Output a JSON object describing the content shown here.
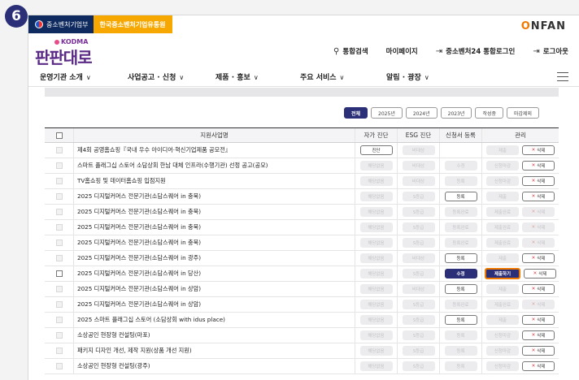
{
  "step": "6",
  "topbar": {
    "ministry": "중소벤처기업부",
    "agency": "한국중소벤처기업유통원",
    "brand": "ONFAN",
    "brand_first": "O",
    "brand_rest": "NFAN"
  },
  "logo": {
    "sub": "KODMA",
    "main": "판판대로"
  },
  "util": {
    "search": "통합검색",
    "mypage": "마이페이지",
    "login24": "중소벤처24 통합로그인",
    "logout": "로그아웃"
  },
  "nav": [
    {
      "label": "운영기관 소개"
    },
    {
      "label": "사업공고 · 신청"
    },
    {
      "label": "제품 · 홍보"
    },
    {
      "label": "주요 서비스"
    },
    {
      "label": "알림 · 광장"
    }
  ],
  "filters": [
    "전체",
    "2025년",
    "2024년",
    "2023년",
    "작성중",
    "마감제외"
  ],
  "table": {
    "headers": {
      "name": "지원사업명",
      "self": "자가 진단",
      "esg": "ESG 진단",
      "reg": "신청서 등록",
      "mgmt": "관리"
    },
    "rows": [
      {
        "name": "제4회 공영홈쇼핑『국내 우수 아이디어·혁신기업제품 공모전』",
        "self": "진단",
        "self_state": "outline",
        "esg": "비대상",
        "esg_state": "disabled",
        "reg": "",
        "reg_state": "none",
        "mgmt": "제출",
        "mgmt_state": "disabled",
        "del": "삭제",
        "del_state": "active",
        "checkbox": "dim"
      },
      {
        "name": "스마트 플래그십 스토어 소담상회 한남 대체 인프라(수행기관) 선정 공고(공모)",
        "self": "해당없음",
        "self_state": "disabled",
        "esg": "비대상",
        "esg_state": "disabled",
        "reg": "수정",
        "reg_state": "disabled",
        "mgmt": "신청마감",
        "mgmt_state": "disabled",
        "del": "삭제",
        "del_state": "active",
        "checkbox": "dim"
      },
      {
        "name": "TV홈쇼핑 및 데이터홈쇼핑 입점지원",
        "self": "해당없음",
        "self_state": "disabled",
        "esg": "비대상",
        "esg_state": "disabled",
        "reg": "등록",
        "reg_state": "disabled",
        "mgmt": "신청마감",
        "mgmt_state": "disabled",
        "del": "삭제",
        "del_state": "active",
        "checkbox": "dim"
      },
      {
        "name": "2025 디지털커머스 전문기관(소담스퀘어 in 충북)",
        "self": "해당없음",
        "self_state": "disabled",
        "esg": "S등급",
        "esg_state": "disabled",
        "reg": "등록",
        "reg_state": "outline",
        "mgmt": "제출",
        "mgmt_state": "disabled",
        "del": "삭제",
        "del_state": "active",
        "checkbox": "dim"
      },
      {
        "name": "2025 디지털커머스 전문기관(소담스퀘어 in 충북)",
        "self": "해당없음",
        "self_state": "disabled",
        "esg": "S등급",
        "esg_state": "disabled",
        "reg": "등록완료",
        "reg_state": "disabled",
        "mgmt": "제출완료",
        "mgmt_state": "disabled",
        "del": "삭제",
        "del_state": "dim",
        "checkbox": "dim"
      },
      {
        "name": "2025 디지털커머스 전문기관(소담스퀘어 in 충북)",
        "self": "해당없음",
        "self_state": "disabled",
        "esg": "S등급",
        "esg_state": "disabled",
        "reg": "등록완료",
        "reg_state": "disabled",
        "mgmt": "제출완료",
        "mgmt_state": "disabled",
        "del": "삭제",
        "del_state": "dim",
        "checkbox": "dim"
      },
      {
        "name": "2025 디지털커머스 전문기관(소담스퀘어 in 충북)",
        "self": "해당없음",
        "self_state": "disabled",
        "esg": "S등급",
        "esg_state": "disabled",
        "reg": "등록완료",
        "reg_state": "disabled",
        "mgmt": "제출완료",
        "mgmt_state": "disabled",
        "del": "삭제",
        "del_state": "dim",
        "checkbox": "dim"
      },
      {
        "name": "2025 디지털커머스 전문기관(소담스퀘어 in 광주)",
        "self": "해당없음",
        "self_state": "disabled",
        "esg": "비대상",
        "esg_state": "disabled",
        "reg": "등록",
        "reg_state": "outline",
        "mgmt": "제출",
        "mgmt_state": "disabled",
        "del": "삭제",
        "del_state": "active",
        "checkbox": "dim"
      },
      {
        "name": "2025 디지털커머스 전문기관(소담스퀘어 in 당산)",
        "self": "해당없음",
        "self_state": "disabled",
        "esg": "S등급",
        "esg_state": "disabled",
        "reg": "수정",
        "reg_state": "navy",
        "mgmt": "제출하기",
        "mgmt_state": "submit",
        "del": "삭제",
        "del_state": "active",
        "checkbox": "active"
      },
      {
        "name": "2025 디지털커머스 전문기관(소담스퀘어 in 상암)",
        "self": "해당없음",
        "self_state": "disabled",
        "esg": "비대상",
        "esg_state": "disabled",
        "reg": "등록",
        "reg_state": "outline",
        "mgmt": "제출",
        "mgmt_state": "disabled",
        "del": "삭제",
        "del_state": "active",
        "checkbox": "dim"
      },
      {
        "name": "2025 디지털커머스 전문기관(소담스퀘어 in 상암)",
        "self": "해당없음",
        "self_state": "disabled",
        "esg": "S등급",
        "esg_state": "disabled",
        "reg": "등록완료",
        "reg_state": "disabled",
        "mgmt": "제출완료",
        "mgmt_state": "disabled",
        "del": "삭제",
        "del_state": "dim",
        "checkbox": "dim"
      },
      {
        "name": "2025 스마트 플래그십 스토어 (소담상회 with idus place)",
        "self": "해당없음",
        "self_state": "disabled",
        "esg": "S등급",
        "esg_state": "disabled",
        "reg": "등록",
        "reg_state": "outline",
        "mgmt": "제출",
        "mgmt_state": "disabled",
        "del": "삭제",
        "del_state": "active",
        "checkbox": "dim"
      },
      {
        "name": "소상공인 현장형 컨설팅(마포)",
        "self": "해당없음",
        "self_state": "disabled",
        "esg": "S등급",
        "esg_state": "disabled",
        "reg": "등록",
        "reg_state": "disabled",
        "mgmt": "신청마감",
        "mgmt_state": "disabled",
        "del": "삭제",
        "del_state": "active",
        "checkbox": "dim"
      },
      {
        "name": "패키지 디자인 개선, 제작 지원(상품 개선 지원)",
        "self": "해당없음",
        "self_state": "disabled",
        "esg": "S등급",
        "esg_state": "disabled",
        "reg": "등록",
        "reg_state": "disabled",
        "mgmt": "신청마감",
        "mgmt_state": "disabled",
        "del": "삭제",
        "del_state": "active",
        "checkbox": "dim"
      },
      {
        "name": "소상공인 현장형 컨설팅(광주)",
        "self": "해당없음",
        "self_state": "disabled",
        "esg": "S등급",
        "esg_state": "disabled",
        "reg": "등록",
        "reg_state": "disabled",
        "mgmt": "신청마감",
        "mgmt_state": "disabled",
        "del": "삭제",
        "del_state": "active",
        "checkbox": "dim"
      }
    ]
  },
  "colors": {
    "navy": "#2b2f77",
    "orange": "#f07a00",
    "yellow": "#f6a800",
    "purple": "#5a2a86"
  }
}
